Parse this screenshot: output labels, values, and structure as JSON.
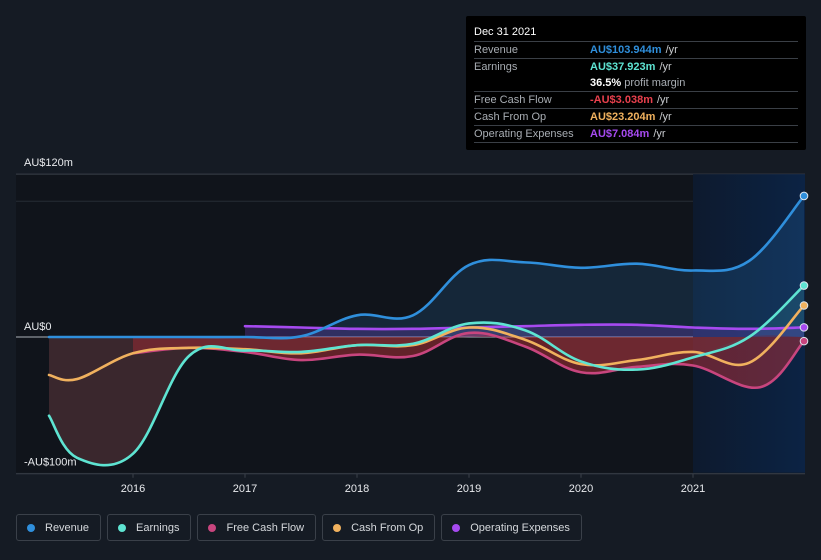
{
  "tooltip": {
    "date": "Dec 31 2021",
    "rows": [
      {
        "label": "Revenue",
        "value": "AU$103.944m",
        "unit": "/yr",
        "color": "#2f8fdc"
      },
      {
        "label": "Earnings",
        "value": "AU$37.923m",
        "unit": "/yr",
        "color": "#5ee4d2"
      },
      {
        "label": "",
        "margin_value": "36.5%",
        "margin_text": "profit margin"
      },
      {
        "label": "Free Cash Flow",
        "value": "-AU$3.038m",
        "unit": "/yr",
        "color": "#e8404d"
      },
      {
        "label": "Cash From Op",
        "value": "AU$23.204m",
        "unit": "/yr",
        "color": "#f0b15e"
      },
      {
        "label": "Operating Expenses",
        "value": "AU$7.084m",
        "unit": "/yr",
        "color": "#a64af0"
      }
    ]
  },
  "legend": [
    {
      "label": "Revenue",
      "color": "#2f8fdc"
    },
    {
      "label": "Earnings",
      "color": "#5ee4d2"
    },
    {
      "label": "Free Cash Flow",
      "color": "#c8457e"
    },
    {
      "label": "Cash From Op",
      "color": "#f0b15e"
    },
    {
      "label": "Operating Expenses",
      "color": "#a64af0"
    }
  ],
  "chart_data": {
    "type": "line",
    "title": "",
    "xlabel": "",
    "ylabel": "",
    "ylim": [
      -100,
      120
    ],
    "xlim": [
      2015.25,
      2022.0
    ],
    "y_ticks": [
      {
        "value": 120,
        "label": "AU$120m"
      },
      {
        "value": 0,
        "label": "AU$0"
      },
      {
        "value": -100,
        "label": "-AU$100m"
      }
    ],
    "x_ticks": [
      {
        "value": 2016,
        "label": "2016"
      },
      {
        "value": 2017,
        "label": "2017"
      },
      {
        "value": 2018,
        "label": "2018"
      },
      {
        "value": 2019,
        "label": "2019"
      },
      {
        "value": 2020,
        "label": "2020"
      },
      {
        "value": 2021,
        "label": "2021"
      }
    ],
    "highlight_range": [
      2021.0,
      2022.0
    ],
    "units": "AU$ millions per year",
    "series": [
      {
        "name": "Revenue",
        "color": "#2f8fdc",
        "fill": true,
        "x": [
          2015.25,
          2016.0,
          2016.5,
          2017.0,
          2017.5,
          2018.0,
          2018.5,
          2019.0,
          2019.5,
          2020.0,
          2020.5,
          2021.0,
          2021.5,
          2022.0
        ],
        "values": [
          0,
          0,
          0,
          0,
          0.5,
          16,
          16,
          53,
          55,
          51,
          54,
          49,
          56,
          103.944
        ]
      },
      {
        "name": "Earnings",
        "color": "#5ee4d2",
        "fill": true,
        "x": [
          2015.25,
          2015.5,
          2016.0,
          2016.5,
          2017.0,
          2017.5,
          2018.0,
          2018.5,
          2019.0,
          2019.5,
          2020.0,
          2020.5,
          2021.0,
          2021.5,
          2022.0
        ],
        "values": [
          -58,
          -89,
          -86,
          -14,
          -10,
          -11,
          -6,
          -5,
          10,
          5,
          -18,
          -24,
          -15,
          0,
          37.923
        ]
      },
      {
        "name": "Free Cash Flow",
        "color": "#c8457e",
        "fill": true,
        "x": [
          2016.0,
          2016.5,
          2017.0,
          2017.5,
          2018.0,
          2018.5,
          2019.0,
          2019.5,
          2020.0,
          2020.5,
          2021.0,
          2021.6,
          2022.0
        ],
        "values": [
          -12,
          -8,
          -11,
          -17,
          -13,
          -14,
          3,
          -7,
          -26,
          -22,
          -21,
          -37,
          -3.038
        ]
      },
      {
        "name": "Cash From Op",
        "color": "#f0b15e",
        "fill": false,
        "x": [
          2015.25,
          2015.5,
          2016.0,
          2016.5,
          2017.0,
          2017.5,
          2018.0,
          2018.5,
          2019.0,
          2019.5,
          2020.0,
          2020.5,
          2021.0,
          2021.5,
          2022.0
        ],
        "values": [
          -28,
          -31,
          -12,
          -8,
          -9,
          -12,
          -6,
          -6,
          7,
          -2,
          -20,
          -17,
          -11,
          -19,
          23.204
        ]
      },
      {
        "name": "Operating Expenses",
        "color": "#a64af0",
        "fill": true,
        "x": [
          2017.0,
          2017.5,
          2018.0,
          2018.5,
          2019.0,
          2019.5,
          2020.0,
          2020.5,
          2021.0,
          2021.5,
          2022.0
        ],
        "values": [
          8,
          7,
          6,
          6,
          7,
          8,
          9,
          9,
          7,
          6,
          7.084
        ]
      }
    ]
  }
}
